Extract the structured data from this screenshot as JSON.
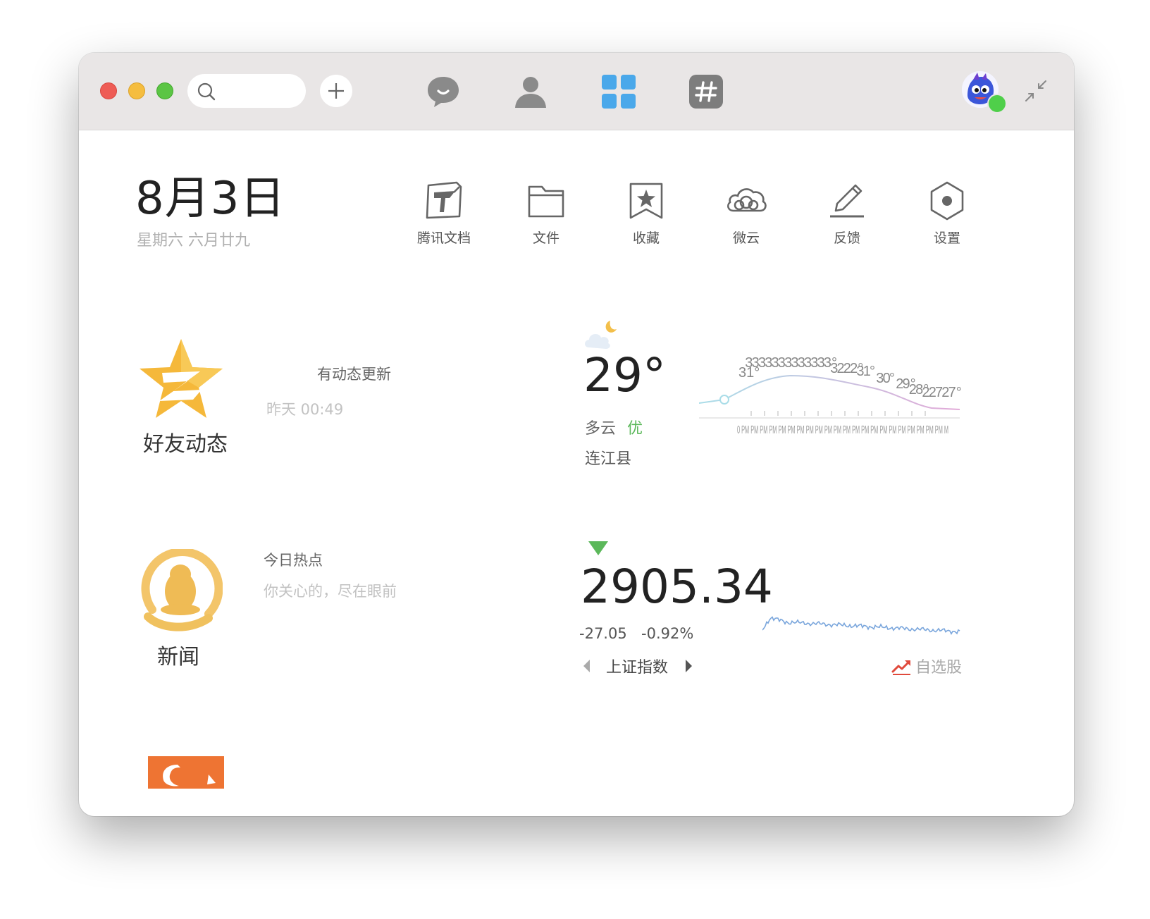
{
  "titlebar": {
    "search": {
      "value": "",
      "placeholder": ""
    },
    "nav": [
      {
        "id": "messages",
        "icon": "chat-bubble-icon",
        "color": "#8a8a8a"
      },
      {
        "id": "contacts",
        "icon": "contact-person-icon",
        "color": "#8a8a8a"
      },
      {
        "id": "apps",
        "icon": "apps-grid-icon",
        "color": "#4aa8ea",
        "active": true
      },
      {
        "id": "channels",
        "icon": "hash-icon",
        "color": "#8a8a8a"
      }
    ]
  },
  "header": {
    "date": "8月3日",
    "subdate": "星期六  六月廿九"
  },
  "tools": [
    {
      "label": "腾讯文档",
      "icon": "tencent-docs-icon"
    },
    {
      "label": "文件",
      "icon": "folder-icon"
    },
    {
      "label": "收藏",
      "icon": "favorites-star-icon"
    },
    {
      "label": "微云",
      "icon": "weiyun-cloud-icon"
    },
    {
      "label": "反馈",
      "icon": "feedback-pencil-icon"
    },
    {
      "label": "设置",
      "icon": "settings-hex-icon"
    }
  ],
  "qzone": {
    "title": "好友动态",
    "headline": "有动态更新",
    "time": "昨天 00:49"
  },
  "news": {
    "title": "新闻",
    "headline": "今日热点",
    "subtitle": "你关心的，尽在眼前"
  },
  "weather": {
    "temp": "29°",
    "desc": "多云",
    "aqi": "优",
    "city": "连江县",
    "icon": "partly-cloudy-night-icon",
    "line_color": "#a9dde8",
    "line_color_end": "#e2a9d8",
    "temp_labels": [
      "31°",
      "3",
      "3",
      "3",
      "3",
      "3",
      "3",
      "3",
      "3",
      "3",
      "3",
      "3",
      "3",
      "3°",
      "3",
      "2",
      "2",
      "2°",
      "3",
      "1",
      "°",
      "3",
      "0",
      "°",
      "2",
      "9°",
      "2",
      "8°",
      "2",
      "2",
      "7",
      "2",
      "7°"
    ],
    "time_labels": "0 PM PM PM PM PM PM PM PM PM PM PM PM PM PM PM PM PM PM PM PM PM PM M"
  },
  "stock": {
    "value": "2905.34",
    "change": "-27.05",
    "percent": "-0.92%",
    "name": "上证指数",
    "trend_color": "#5bb85a",
    "line_color": "#7aa6dc",
    "watch_label": "自选股",
    "watch_icon_color": "#e04a3c"
  }
}
